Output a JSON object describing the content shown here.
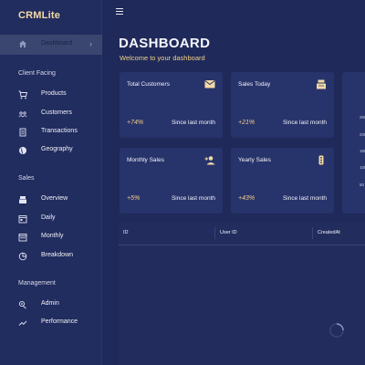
{
  "app": {
    "brand": "CRMLite"
  },
  "sidebar": {
    "active": {
      "label": "Dashboard"
    },
    "sections": [
      {
        "title": "Client Facing",
        "items": [
          {
            "label": "Products",
            "icon": "cart-icon"
          },
          {
            "label": "Customers",
            "icon": "people-icon"
          },
          {
            "label": "Transactions",
            "icon": "receipt-icon"
          },
          {
            "label": "Geography",
            "icon": "globe-icon"
          }
        ]
      },
      {
        "title": "Sales",
        "items": [
          {
            "label": "Overview",
            "icon": "point-of-sale-icon"
          },
          {
            "label": "Daily",
            "icon": "calendar-day-icon"
          },
          {
            "label": "Monthly",
            "icon": "calendar-month-icon"
          },
          {
            "label": "Breakdown",
            "icon": "pie-chart-icon"
          }
        ]
      },
      {
        "title": "Management",
        "items": [
          {
            "label": "Admin",
            "icon": "admin-icon"
          },
          {
            "label": "Performance",
            "icon": "trending-up-icon"
          }
        ]
      }
    ]
  },
  "header": {
    "title": "DASHBOARD",
    "subtitle": "Welcome to your dashboard"
  },
  "stats": [
    {
      "title": "Total Customers",
      "pct": "+74%",
      "since": "Since last month",
      "icon": "email-icon"
    },
    {
      "title": "Sales Today",
      "pct": "+21%",
      "since": "Since last month",
      "icon": "point-of-sale-icon"
    },
    {
      "title": "Monthly Sales",
      "pct": "+5%",
      "since": "Since last month",
      "icon": "person-add-icon"
    },
    {
      "title": "Yearly Sales",
      "pct": "+43%",
      "since": "Since last month",
      "icon": "traffic-icon"
    }
  ],
  "side_panel": {
    "ticks": [
      "250",
      "200",
      "150",
      "100",
      "50"
    ]
  },
  "table": {
    "columns": [
      "ID",
      "User ID",
      "CreatedAt"
    ]
  },
  "colors": {
    "background": "#1f2a5a",
    "sidebar": "#212c5f",
    "card": "#27336b",
    "accent": "#f3cf86",
    "active_item": "#3a466f"
  }
}
